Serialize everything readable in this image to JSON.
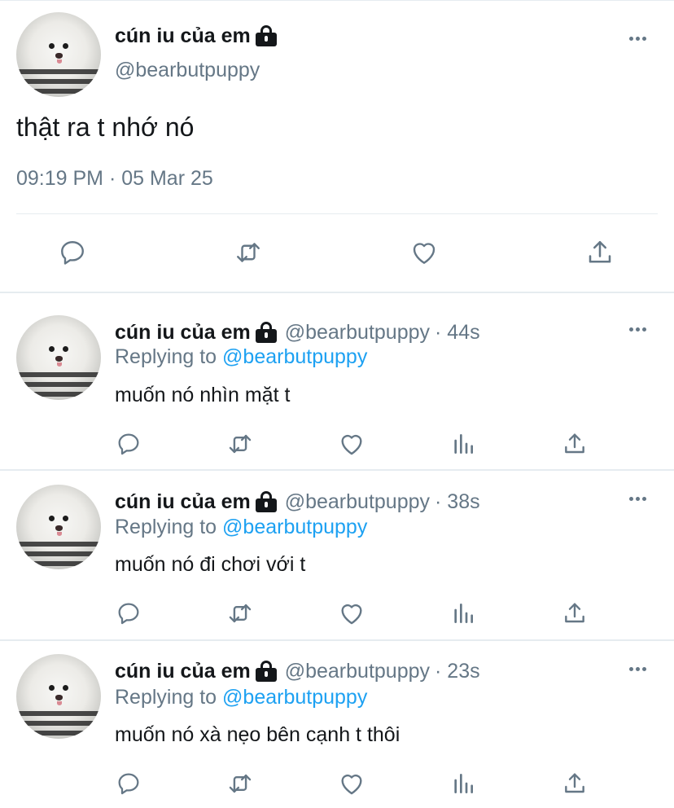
{
  "main_tweet": {
    "display_name": "cún iu của em",
    "handle": "@bearbutpuppy",
    "text": "thật ra t nhớ nó",
    "timestamp": "09:19 PM · 05 Mar 25",
    "actions": [
      "reply-icon",
      "retweet-icon",
      "like-icon",
      "share-icon"
    ]
  },
  "replies": [
    {
      "display_name": "cún iu của em",
      "handle": "@bearbutpuppy",
      "time": "· 44s",
      "replying_label": "Replying to",
      "replying_handle": "@bearbutpuppy",
      "text": "muốn nó nhìn mặt t"
    },
    {
      "display_name": "cún iu của em",
      "handle": "@bearbutpuppy",
      "time": "· 38s",
      "replying_label": "Replying to",
      "replying_handle": "@bearbutpuppy",
      "text": "muốn nó đi chơi với t"
    },
    {
      "display_name": "cún iu của em",
      "handle": "@bearbutpuppy",
      "time": "· 23s",
      "replying_label": "Replying to",
      "replying_handle": "@bearbutpuppy",
      "text": "muốn nó xà nẹo bên cạnh t thôi"
    }
  ],
  "colors": {
    "text": "#14171a",
    "muted": "#657786",
    "link": "#1da1f2",
    "divider": "#e6ecf0"
  }
}
